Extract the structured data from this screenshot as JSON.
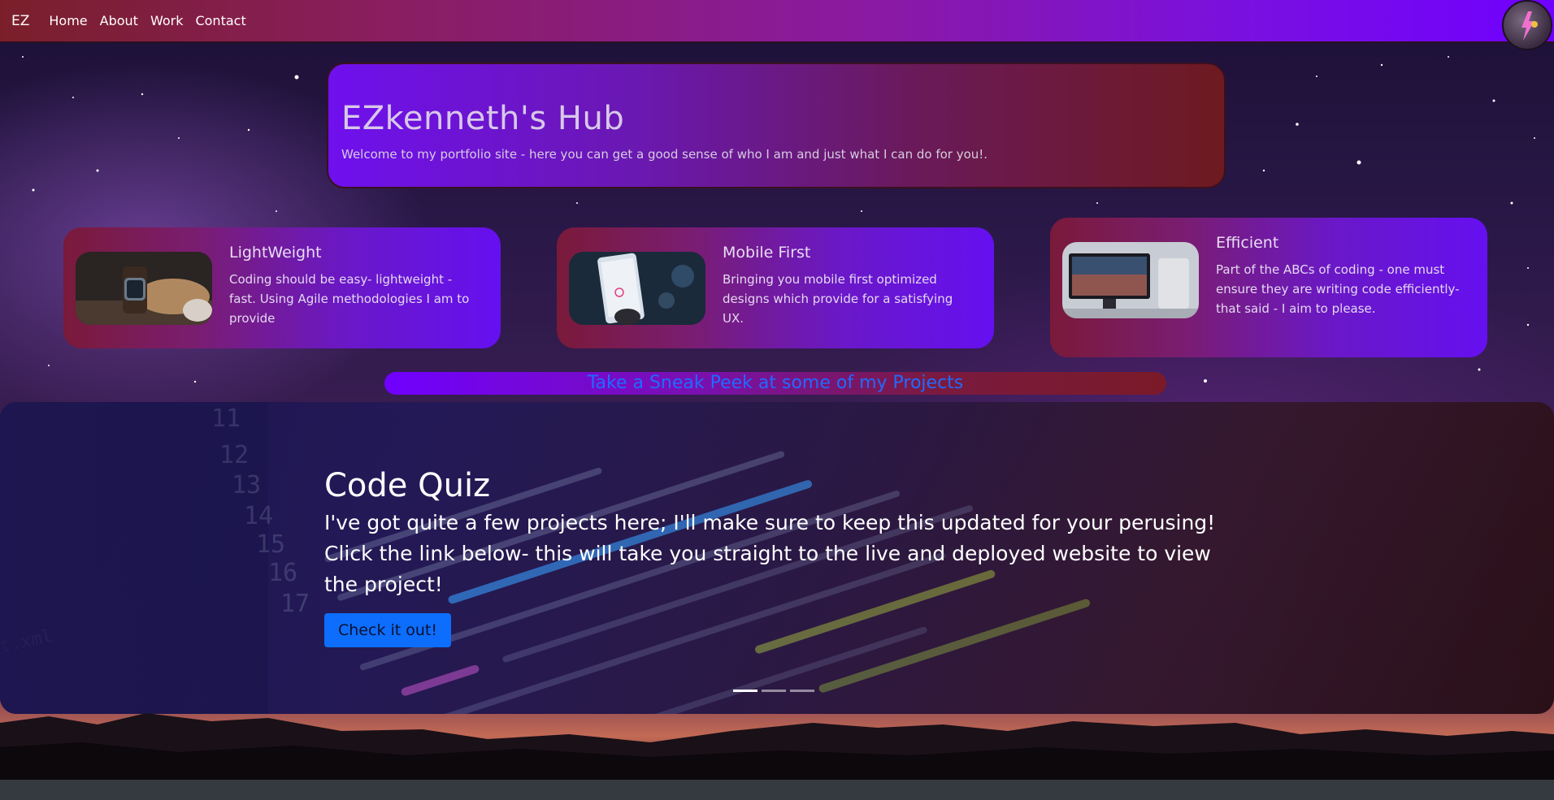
{
  "nav": {
    "brand": "EZ",
    "links": [
      "Home",
      "About",
      "Work",
      "Contact"
    ]
  },
  "hero": {
    "title": "EZkenneth's Hub",
    "subtitle": "Welcome to my portfolio site - here you can get a good sense of who I am and just what I can do for you!."
  },
  "cards": [
    {
      "title": "LightWeight",
      "text": "Coding should be easy- lightweight - fast. Using Agile methodologies I am to provide",
      "image": "wristwatch-photo"
    },
    {
      "title": "Mobile First",
      "text": "Bringing you mobile first optimized designs which provide for a satisfying UX.",
      "image": "smartphone-photo"
    },
    {
      "title": "Efficient",
      "text": "Part of the ABCs of coding - one must ensure they are writing code efficiently- that said - I aim to please.",
      "image": "computer-setup-photo"
    }
  ],
  "peek": {
    "label": "Take a Sneak Peek at some of my Projects"
  },
  "carousel": {
    "title": "Code Quiz",
    "text": "I've got quite a few projects here; I'll make sure to keep this updated for your perusing! Click the link below- this will take you straight to the live and deployed website to view the project!",
    "button_label": "Check it out!",
    "slide_count": 3,
    "active_slide": 1
  },
  "colors": {
    "accent_blue": "#0d6efd",
    "nav_start": "#7a1f2a",
    "nav_end": "#7000ff",
    "footer": "#343a40"
  }
}
